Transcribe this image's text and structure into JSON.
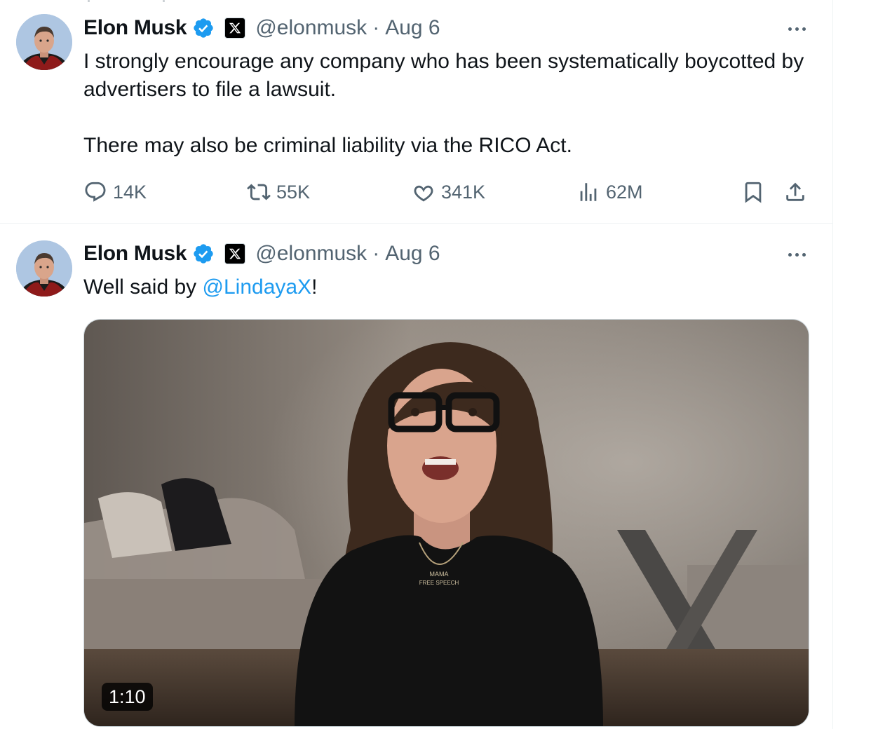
{
  "tweets": [
    {
      "author_name": "Elon Musk",
      "handle": "@elonmusk",
      "separator": "·",
      "date": "Aug 6",
      "text_paragraphs": [
        "I strongly encourage any company who has been systematically boycotted by advertisers to file a lawsuit.",
        "There may also be criminal liability via the RICO Act."
      ],
      "stats": {
        "replies": "14K",
        "reposts": "55K",
        "likes": "341K",
        "views": "62M"
      }
    },
    {
      "author_name": "Elon Musk",
      "handle": "@elonmusk",
      "separator": "·",
      "date": "Aug 6",
      "text_prefix": "Well said by ",
      "mention": "@LindayaX",
      "text_suffix": "!",
      "media": {
        "type": "video",
        "duration": "1:10",
        "necklace_text": [
          "MAMA",
          "FREE SPEECH"
        ]
      }
    }
  ],
  "colors": {
    "accent": "#1d9bf0",
    "secondary_text": "#536471",
    "verified": "#1d9bf0"
  },
  "icons": [
    "verified-badge-icon",
    "x-affiliate-icon",
    "more-icon",
    "reply-icon",
    "repost-icon",
    "like-icon",
    "views-icon",
    "bookmark-icon",
    "share-icon"
  ]
}
